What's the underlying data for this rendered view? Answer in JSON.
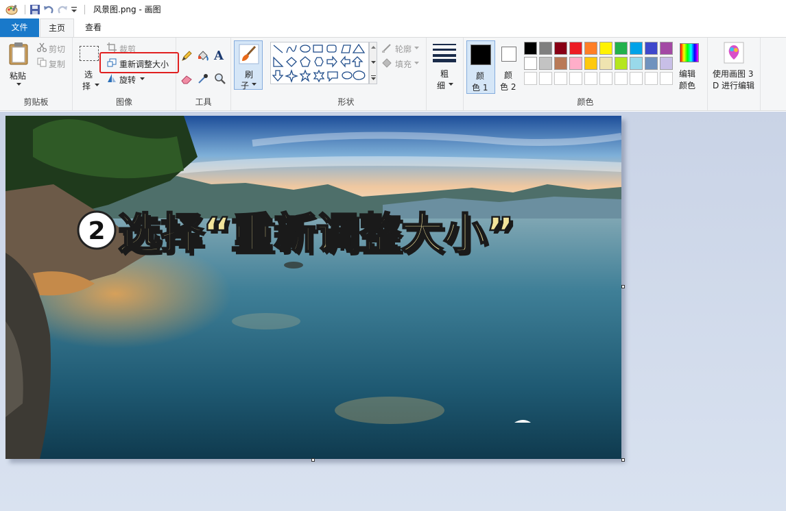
{
  "window": {
    "title": "风景图.png - 画图"
  },
  "tabs": {
    "file": "文件",
    "home": "主页",
    "view": "查看"
  },
  "clipboard": {
    "paste": "粘贴",
    "cut": "剪切",
    "copy": "复制",
    "label": "剪贴板"
  },
  "image": {
    "select_line1": "选",
    "select_line2": "择",
    "crop": "裁剪",
    "resize": "重新调整大小",
    "rotate": "旋转",
    "label": "图像"
  },
  "tools": {
    "label": "工具",
    "text_tool": "A"
  },
  "brushes": {
    "line1": "刷",
    "line2": "子"
  },
  "shapes": {
    "outline": "轮廓",
    "fill": "填充",
    "label": "形状"
  },
  "size": {
    "line1": "粗",
    "line2": "细"
  },
  "colors": {
    "color1_line1": "颜",
    "color1_line2": "色 1",
    "color2_line1": "颜",
    "color2_line2": "色 2",
    "edit_line1": "编辑",
    "edit_line2": "颜色",
    "label": "颜色",
    "color1_value": "#000000",
    "color2_value": "#ffffff",
    "palette": [
      "#000000",
      "#7f7f7f",
      "#880015",
      "#ed1c24",
      "#ff7f27",
      "#fff200",
      "#22b14c",
      "#00a2e8",
      "#3f48cc",
      "#a349a4",
      "#ffffff",
      "#c3c3c3",
      "#b97a57",
      "#ffaec9",
      "#ffc90e",
      "#efe4b0",
      "#b5e61d",
      "#99d9ea",
      "#7092be",
      "#c8bfe7"
    ]
  },
  "paint3d": {
    "line1": "使用画图 3",
    "line2": "D 进行编辑"
  },
  "canvas": {
    "overlay_number": "2",
    "overlay_text": "选择“重新调整大小”"
  }
}
